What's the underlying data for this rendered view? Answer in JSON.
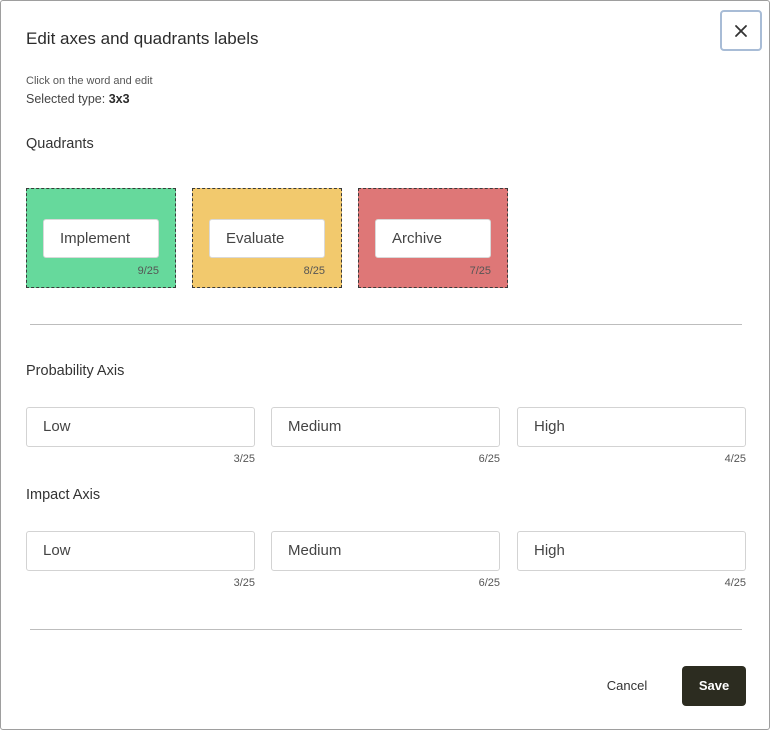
{
  "dialog": {
    "title": "Edit axes and quadrants labels",
    "close_icon": "close-icon"
  },
  "instructions": {
    "hint": "Click on the word and edit",
    "selected_type_label": "Selected type: ",
    "selected_type_value": "3x3"
  },
  "quadrants": {
    "title": "Quadrants",
    "items": [
      {
        "label": "Implement",
        "count": "9/25",
        "color": "#66d99c"
      },
      {
        "label": "Evaluate",
        "count": "8/25",
        "color": "#f2c96d"
      },
      {
        "label": "Archive",
        "count": "7/25",
        "color": "#de7777"
      }
    ]
  },
  "probability_axis": {
    "title": "Probability Axis",
    "items": [
      {
        "value": "Low",
        "count": "3/25"
      },
      {
        "value": "Medium",
        "count": "6/25"
      },
      {
        "value": "High",
        "count": "4/25"
      }
    ]
  },
  "impact_axis": {
    "title": "Impact Axis",
    "items": [
      {
        "value": "Low",
        "count": "3/25"
      },
      {
        "value": "Medium",
        "count": "6/25"
      },
      {
        "value": "High",
        "count": "4/25"
      }
    ]
  },
  "footer": {
    "cancel_label": "Cancel",
    "save_label": "Save"
  },
  "colors": {
    "save_button_bg": "#2c2c20",
    "close_focus_border": "#a8bcd6"
  }
}
